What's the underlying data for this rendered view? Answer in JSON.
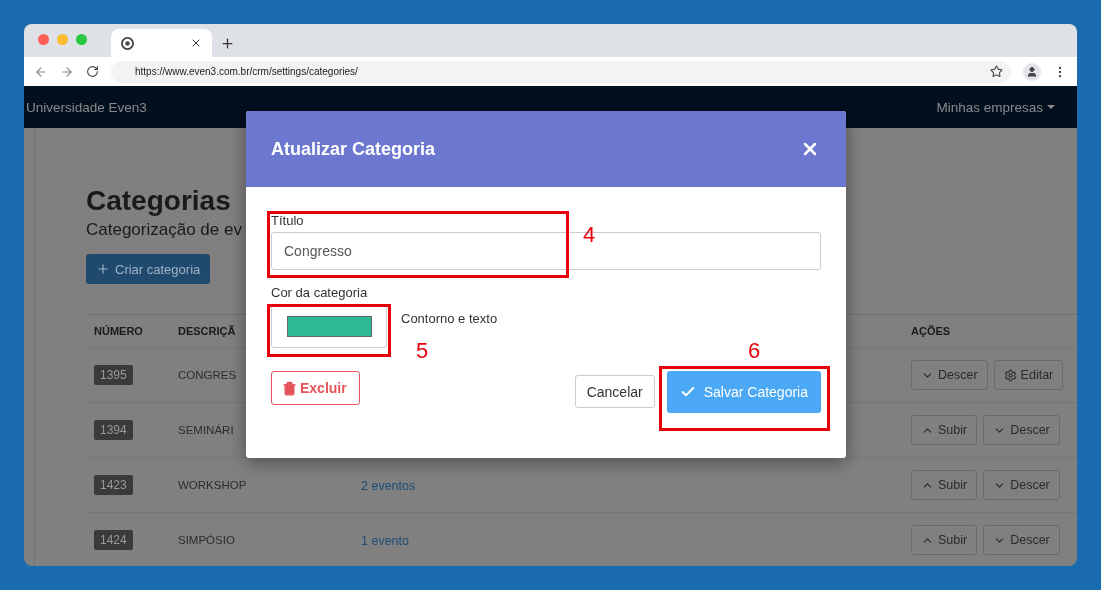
{
  "browser": {
    "url": "https://www.even3.com.br/crm/settings/categories/"
  },
  "navbar": {
    "brand": "Universidade Even3",
    "menu": "Minhas empresas"
  },
  "page": {
    "title": "Categorias",
    "subtitle": "Categorização de ev",
    "create_button": "Criar categoria"
  },
  "table": {
    "columns": [
      "NÚMERO",
      "DESCRIÇÃ",
      "AÇÕES"
    ],
    "rows": [
      {
        "number": "1395",
        "description": "CONGRES",
        "actions": [
          {
            "kind": "down",
            "label": "Descer"
          },
          {
            "kind": "edit",
            "label": "Editar"
          }
        ]
      },
      {
        "number": "1394",
        "description": "SEMINÁRI",
        "actions": [
          {
            "kind": "up",
            "label": "Subir"
          },
          {
            "kind": "down",
            "label": "Descer"
          }
        ]
      },
      {
        "number": "1423",
        "description": "WORKSHOP",
        "events": "2 eventos",
        "actions": [
          {
            "kind": "up",
            "label": "Subir"
          },
          {
            "kind": "down",
            "label": "Descer"
          }
        ]
      },
      {
        "number": "1424",
        "description": "SIMPÓSIO",
        "events": "1 evento",
        "actions": [
          {
            "kind": "up",
            "label": "Subir"
          },
          {
            "kind": "down",
            "label": "Descer"
          }
        ]
      }
    ]
  },
  "modal": {
    "title": "Atualizar Categoria",
    "title_label": "Título",
    "title_value": "Congresso",
    "color_label": "Cor da categoria",
    "color": "#2bb996",
    "color_hint": "Contorno e texto",
    "delete_button": "Excluir",
    "cancel_button": "Cancelar",
    "save_button": "Salvar Categoria"
  },
  "annotations": [
    {
      "label": "4"
    },
    {
      "label": "5"
    },
    {
      "label": "6"
    }
  ]
}
